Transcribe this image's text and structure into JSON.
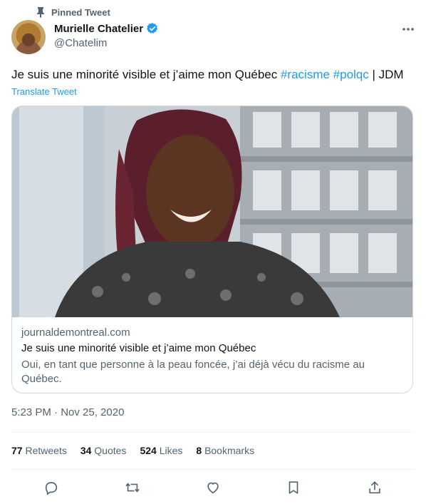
{
  "pinned": {
    "label": "Pinned Tweet"
  },
  "author": {
    "name": "Murielle Chatelier",
    "handle": "@Chatelim"
  },
  "tweet": {
    "text_before": "Je suis une minorité visible et j’aime mon Québec ",
    "hashtag_1": "#racisme",
    "hashtag_2": "#polqc",
    "text_after": " | JDM",
    "translate_label": "Translate Tweet",
    "timestamp": "5:23 PM · Nov 25, 2020"
  },
  "card": {
    "domain": "journaldemontreal.com",
    "title": "Je suis une minorité visible et j’aime mon Québec",
    "description": "Oui, en tant que personne à la peau foncée, j’ai déjà vécu du racisme au Québec."
  },
  "stats": {
    "retweets_count": "77",
    "retweets_label": "Retweets",
    "quotes_count": "34",
    "quotes_label": "Quotes",
    "likes_count": "524",
    "likes_label": "Likes",
    "bookmarks_count": "8",
    "bookmarks_label": "Bookmarks"
  },
  "actions": [
    "reply-icon",
    "retweet-icon",
    "like-icon",
    "bookmark-icon",
    "share-icon"
  ],
  "colors": {
    "accent": "#1d9bf0",
    "text": "#0f1419",
    "muted": "#536471",
    "border": "#cfd9de"
  }
}
